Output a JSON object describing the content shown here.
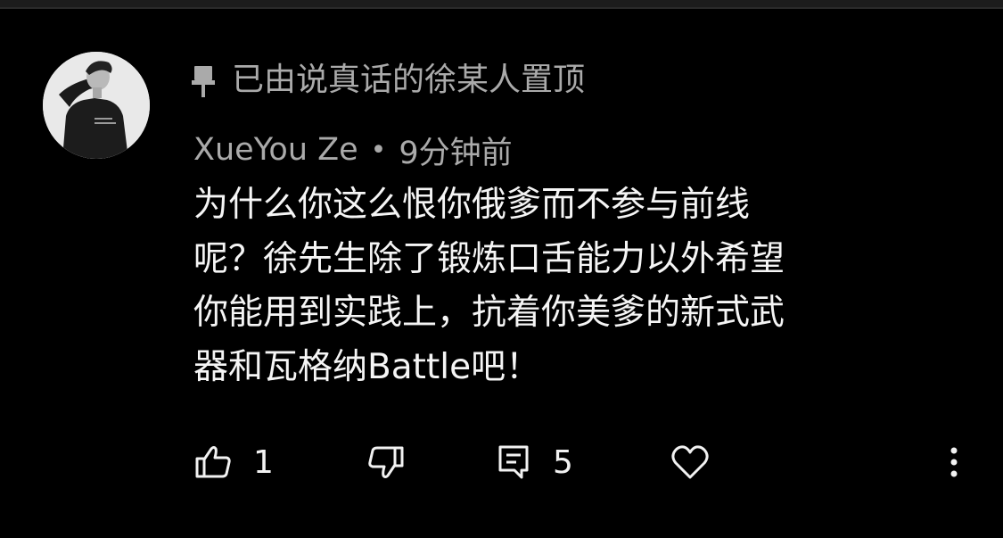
{
  "comment": {
    "pinned_label": "已由说真话的徐某人置顶",
    "author": "XueYou Ze",
    "separator": "•",
    "time": "9分钟前",
    "text": "为什么你这么恨你俄爹而不参与前线\n呢？徐先生除了锻炼口舌能力以外希望\n你能用到实践上，抗着你美爹的新式武\n器和瓦格纳Battle吧！",
    "likes": "1",
    "replies": "5"
  },
  "icons": {
    "pin": "pin-icon",
    "like": "thumbs-up-icon",
    "dislike": "thumbs-down-icon",
    "reply": "comment-icon",
    "heart": "heart-icon",
    "more": "more-vertical-icon"
  },
  "colors": {
    "background": "#000000",
    "secondary_text": "#aaaaaa",
    "primary_text": "#f5f5f5"
  }
}
